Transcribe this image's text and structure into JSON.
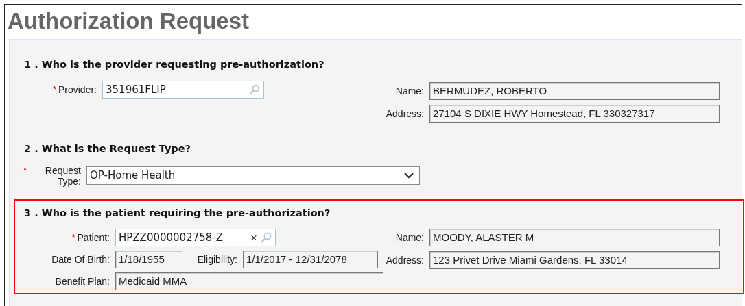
{
  "title": "Authorization Request",
  "sections": [
    {
      "heading": "1 . Who is the provider requesting pre-authorization?",
      "highlighted": false,
      "left": [
        [
          {
            "kind": "lookup",
            "label": "Provider:",
            "required_mark": "*",
            "value": "351961FLIP"
          }
        ]
      ],
      "right": [
        {
          "kind": "readonly",
          "label": "Name:",
          "value": "BERMUDEZ, ROBERTO"
        },
        {
          "kind": "readonly",
          "label": "Address:",
          "value": "27104 S DIXIE HWY Homestead, FL 330327317"
        }
      ]
    },
    {
      "heading": "2 . What is the Request Type?",
      "highlighted": false,
      "left": [
        [
          {
            "kind": "select",
            "label": "Request Type:",
            "required_mark": "*",
            "value": "OP-Home Health"
          }
        ]
      ]
    },
    {
      "heading": "3 . Who is the patient requiring the pre-authorization?",
      "highlighted": true,
      "left": [
        [
          {
            "kind": "lookup",
            "label": "Patient:",
            "required_mark": "*",
            "value": "HPZZ0000002758-Z",
            "clear": "×"
          }
        ],
        [
          {
            "kind": "readonly",
            "label": "Date Of Birth:",
            "value": "1/18/1955"
          },
          {
            "kind": "readonly",
            "label": "Eligibility:",
            "value": "1/1/2017 - 12/31/2078"
          }
        ],
        [
          {
            "kind": "readonly",
            "label": "Benefit Plan:",
            "value": "Medicaid MMA"
          }
        ]
      ],
      "right": [
        {
          "kind": "readonly",
          "label": "Name:",
          "value": "MOODY, ALASTER M"
        },
        {
          "kind": "readonly",
          "label": "Address:",
          "value": "123 Privet Drive Miami Gardens, FL 33014"
        }
      ]
    }
  ]
}
